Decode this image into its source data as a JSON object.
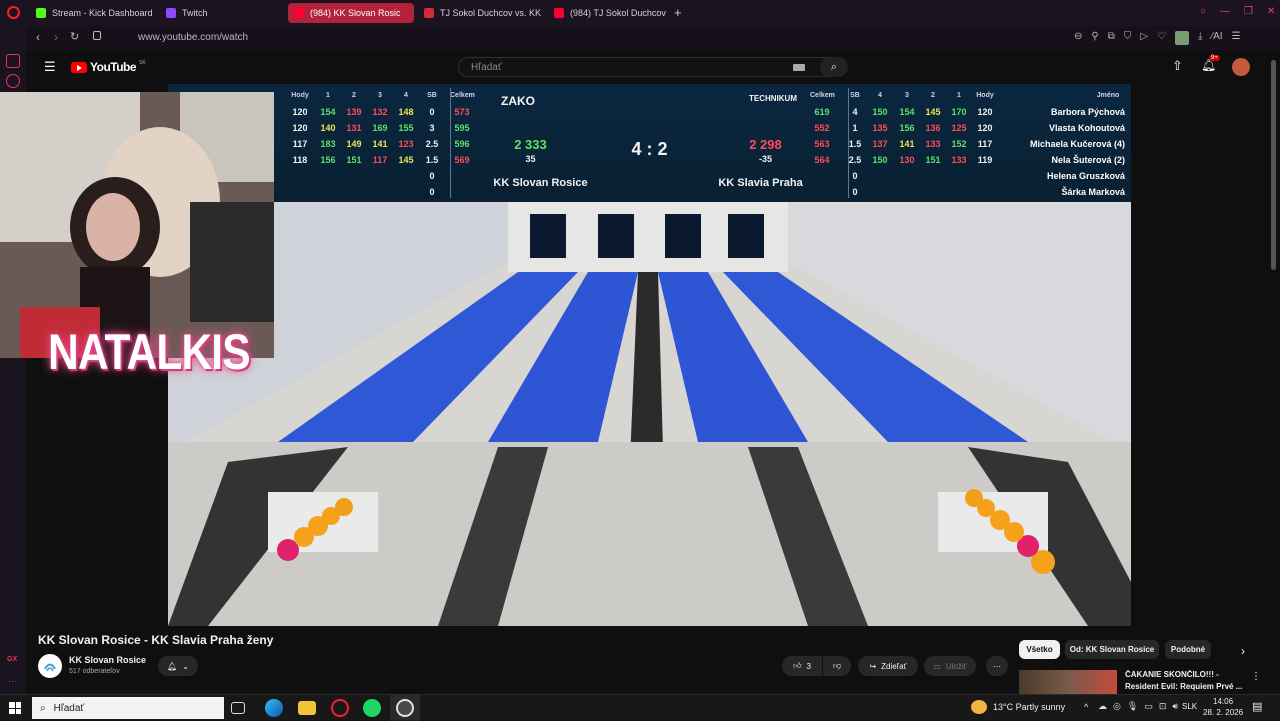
{
  "browser": {
    "tabs": [
      {
        "label": "Stream - Kick Dashboard",
        "fav": "#53fc18"
      },
      {
        "label": "Twitch",
        "fav": "#9146ff"
      },
      {
        "label": "(984) KK Slovan Rosic",
        "fav": "#ff0033",
        "active": true
      },
      {
        "label": "TJ Sokol Duchcov vs. KK",
        "fav": "#d02a3c"
      },
      {
        "label": "(984) TJ Sokol Duchcov -",
        "fav": "#ff0033"
      }
    ],
    "new_tab": "+",
    "url": "www.youtube.com/watch"
  },
  "youtube": {
    "logo_text": "YouTube",
    "region": "SK",
    "search_placeholder": "Hľadať",
    "notif_badge": "9+"
  },
  "scoreboard": {
    "headers_left": [
      "Hody",
      "1",
      "2",
      "3",
      "4",
      "SB",
      "Celkem"
    ],
    "headers_right": [
      "Celkem",
      "SB",
      "4",
      "3",
      "2",
      "1",
      "Hody",
      "Jméno"
    ],
    "left_rows": [
      {
        "hody": "120",
        "r1": "154",
        "r2": "139",
        "r3": "132",
        "r4": "148",
        "sb": "0",
        "total": "573"
      },
      {
        "hody": "120",
        "r1": "140",
        "r2": "131",
        "r3": "169",
        "r4": "155",
        "sb": "3",
        "total": "595"
      },
      {
        "hody": "117",
        "r1": "183",
        "r2": "149",
        "r3": "141",
        "r4": "123",
        "sb": "2.5",
        "total": "596"
      },
      {
        "hody": "118",
        "r1": "156",
        "r2": "151",
        "r3": "117",
        "r4": "145",
        "sb": "1.5",
        "total": "569"
      },
      {
        "hody": "",
        "r1": "",
        "r2": "",
        "r3": "",
        "r4": "",
        "sb": "0",
        "total": ""
      },
      {
        "hody": "",
        "r1": "",
        "r2": "",
        "r3": "",
        "r4": "",
        "sb": "0",
        "total": ""
      }
    ],
    "right_rows": [
      {
        "total": "619",
        "sb": "4",
        "r4": "150",
        "r3": "154",
        "r2": "145",
        "r1": "170",
        "hody": "120",
        "name": "Barbora Pýchová"
      },
      {
        "total": "552",
        "sb": "1",
        "r4": "135",
        "r3": "156",
        "r2": "136",
        "r1": "125",
        "hody": "120",
        "name": "Vlasta Kohoutová"
      },
      {
        "total": "563",
        "sb": "1.5",
        "r4": "137",
        "r3": "141",
        "r2": "133",
        "r1": "152",
        "hody": "117",
        "name": "Michaela Kučerová (4)"
      },
      {
        "total": "564",
        "sb": "2.5",
        "r4": "150",
        "r3": "130",
        "r2": "151",
        "r1": "133",
        "hody": "119",
        "name": "Nela Šuterová (2)"
      },
      {
        "total": "",
        "sb": "0",
        "r4": "",
        "r3": "",
        "r2": "",
        "r1": "",
        "hody": "",
        "name": "Helena Gruszková"
      },
      {
        "total": "",
        "sb": "0",
        "r4": "",
        "r3": "",
        "r2": "",
        "r1": "",
        "hody": "",
        "name": "Šárka Marková"
      }
    ],
    "home": {
      "sponsor": "ZAKO",
      "total": "2 333",
      "diff": "35",
      "name": "KK Slovan Rosice"
    },
    "away": {
      "sponsor": "TECHNIKUM",
      "total": "2 298",
      "diff": "-35",
      "name": "KK Slavia Praha"
    },
    "match_score": "4 : 2",
    "colors": {
      "green": "#5ee06a",
      "red": "#ff4b5b",
      "yellow": "#e8e650"
    }
  },
  "overlay": {
    "streamer_name": "NATALKIS"
  },
  "video_meta": {
    "title": "KK Slovan Rosice - KK Slavia Praha ženy",
    "channel": "KK Slovan Rosice",
    "subscribers": "517 odberateľov",
    "likes": "3",
    "share_label": "Zdieľať",
    "save_label": "Uložiť"
  },
  "chips": [
    "Všetko",
    "Od: KK Slovan Rosice",
    "Podobné"
  ],
  "recommended": {
    "title_line1": "ČAKANIE SKONČILO!!! -",
    "title_line2": "Resident Evil: Requiem Prvé ..."
  },
  "taskbar": {
    "search_placeholder": "Hľadať",
    "weather": "13°C  Partly sunny",
    "lang": "SLK",
    "time": "14:06",
    "date": "28. 2. 2026"
  }
}
